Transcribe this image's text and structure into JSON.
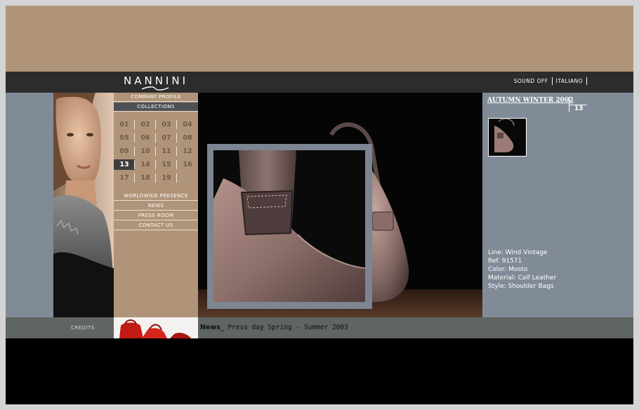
{
  "header": {
    "logo_text": "NANNINI",
    "sound_link": "SOUND OFF",
    "language_link": "ITALIANO"
  },
  "nav": {
    "top_items": [
      "COMPANY PROFILE",
      "COLLECTIONS"
    ],
    "numbers": [
      "01",
      "02",
      "03",
      "04",
      "05",
      "06",
      "07",
      "08",
      "09",
      "10",
      "11",
      "12",
      "13",
      "14",
      "15",
      "16",
      "17",
      "18",
      "19"
    ],
    "active_number": "13",
    "bottom_items": [
      "WORLDWIDE PRESENCE",
      "NEWS",
      "PRESS ROOM",
      "CONTACT US"
    ]
  },
  "collection": {
    "title": "AUTUMN WINTER 2002",
    "item_number": "13",
    "specs": [
      "Line: Wind Vintage",
      "Ref. 91571",
      "Color: Mosto",
      "Material: Calf Leather",
      "Style: Shoulder Bags"
    ]
  },
  "footer": {
    "credits": "CREDITS",
    "news_label": "News_",
    "news_text": "Press day Spring - Summer 2003"
  },
  "colors": {
    "tan": "#b09479",
    "slate": "#808b97",
    "dark_bar": "#2c2c2c",
    "footer_bar": "#5f6560"
  },
  "icons": {
    "logo_swoosh": "logo-swoosh-icon"
  }
}
